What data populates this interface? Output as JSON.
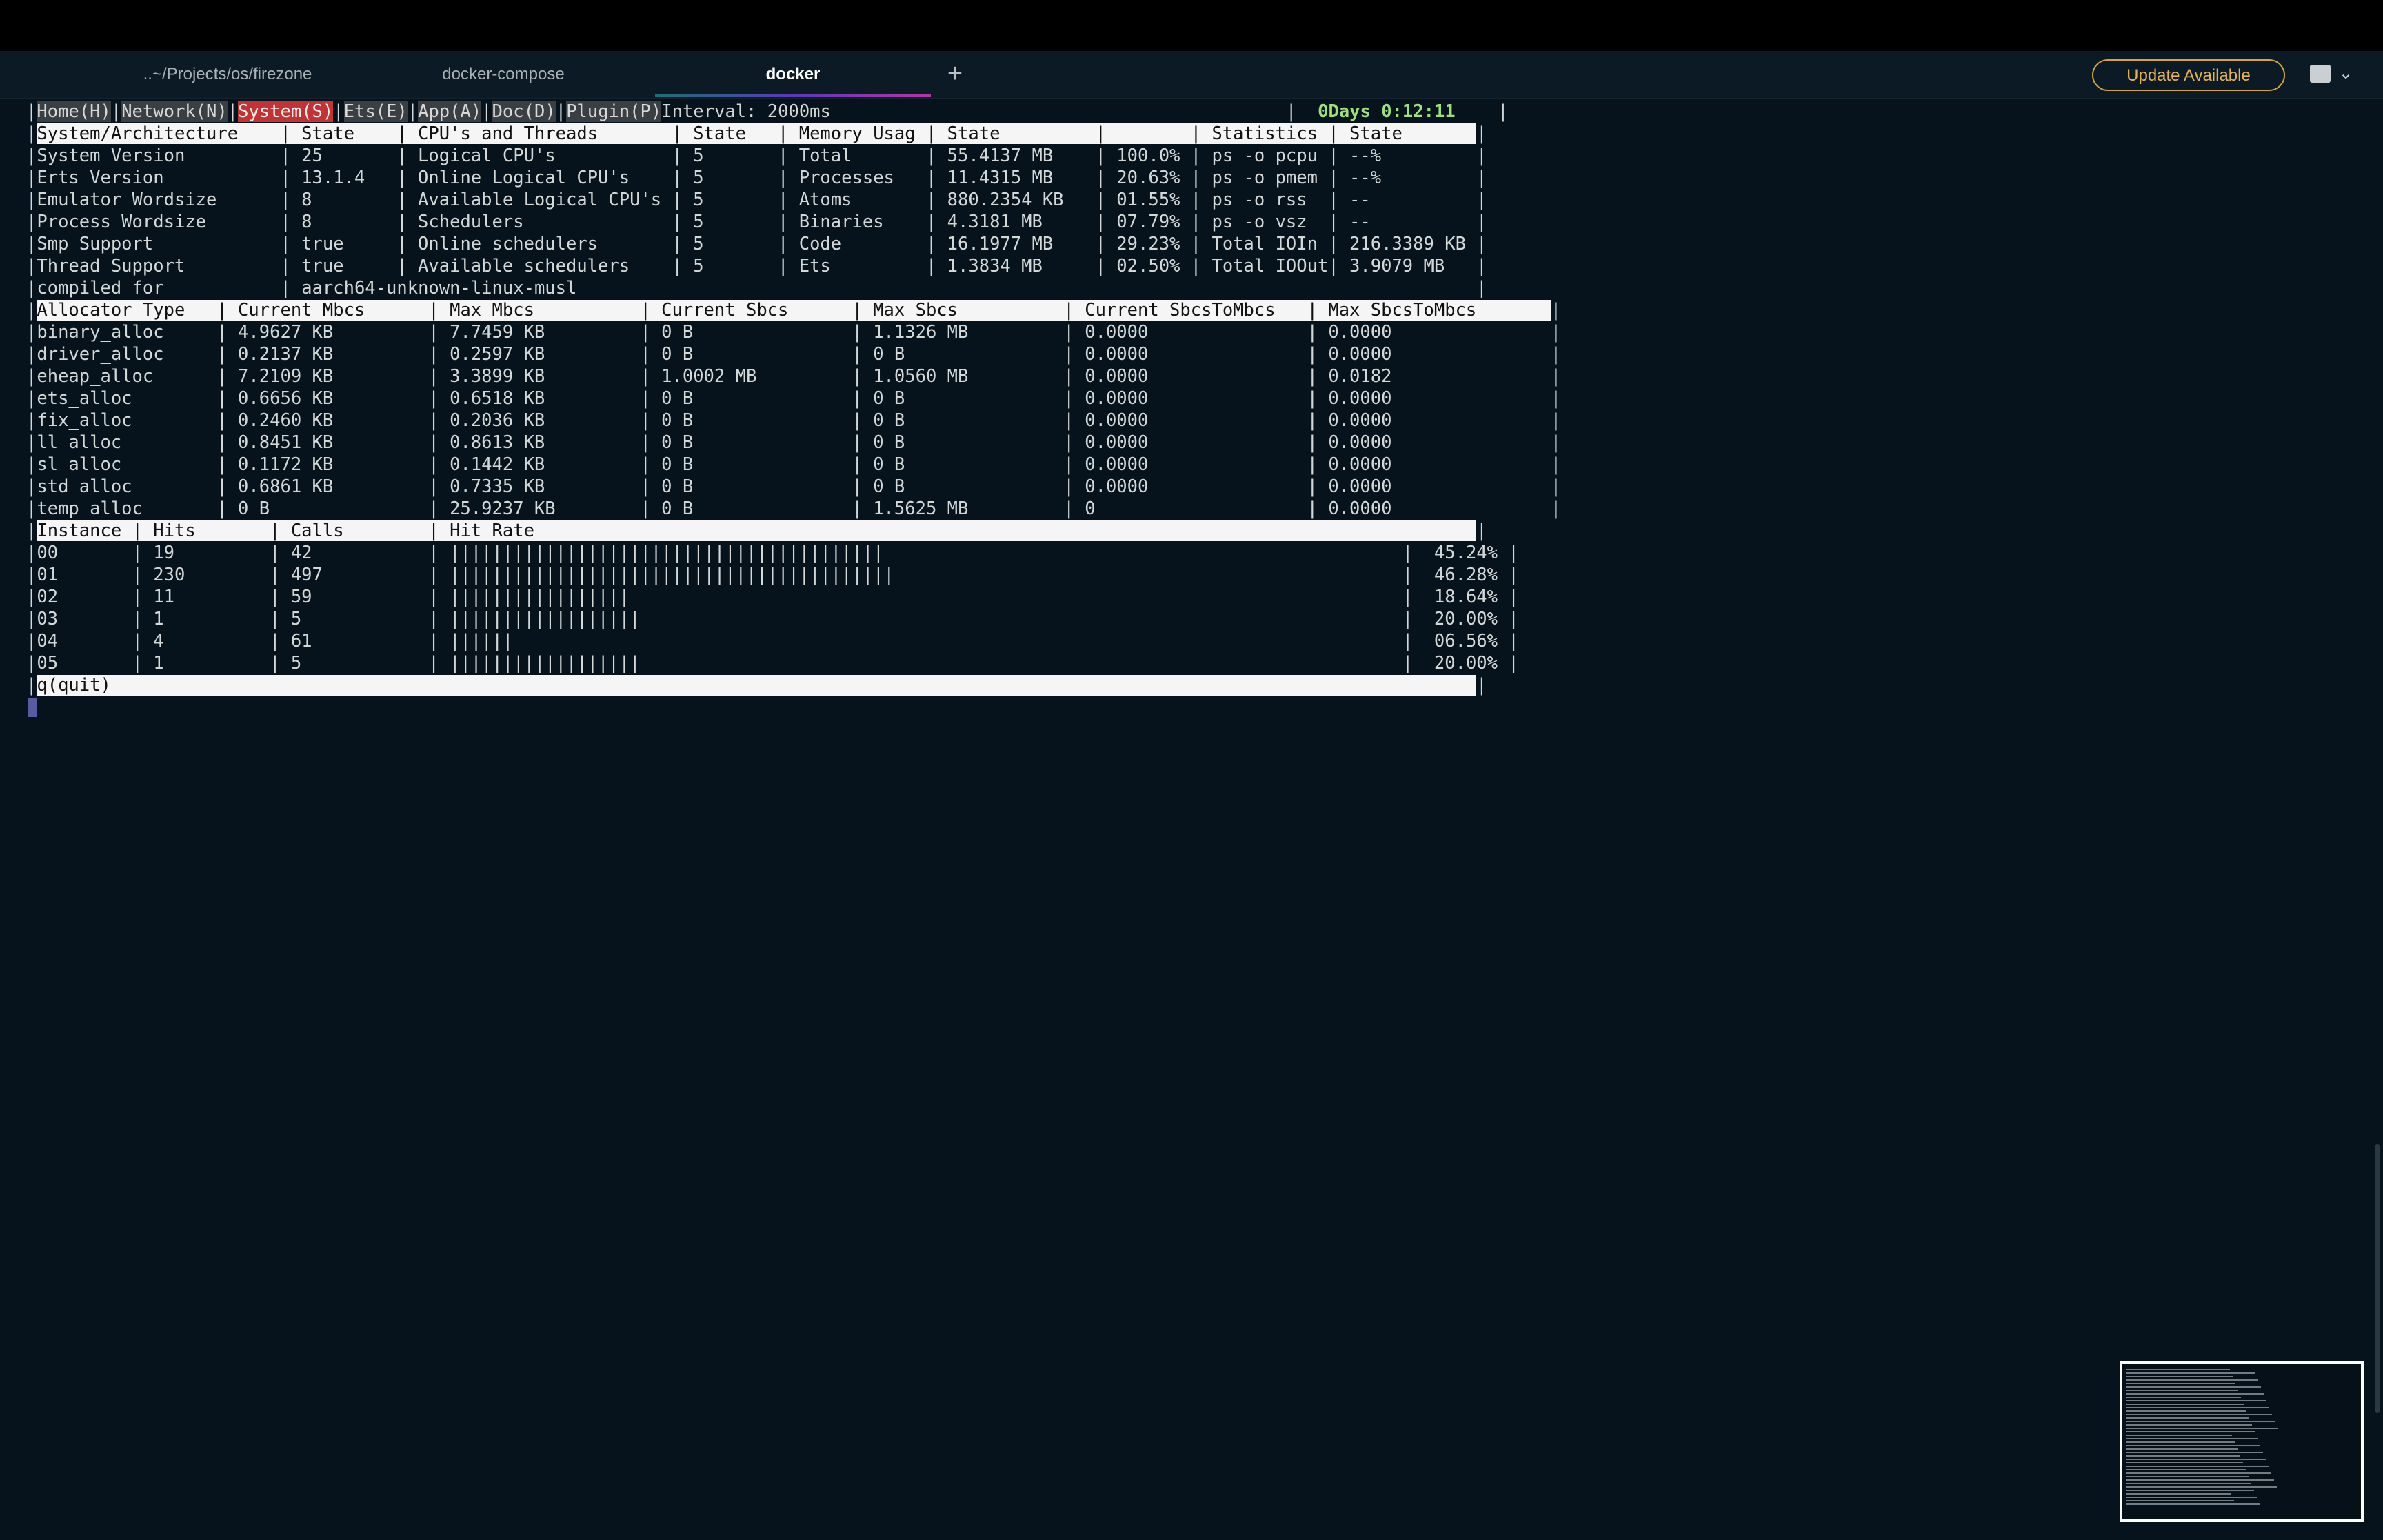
{
  "tabs": [
    {
      "label": "..~/Projects/os/firezone"
    },
    {
      "label": "docker-compose"
    },
    {
      "label": "docker"
    }
  ],
  "update_button": "Update Available",
  "nav": {
    "items": [
      "Home(H)",
      "Network(N)",
      "System(S)",
      "Ets(E)",
      "App(A)",
      "Doc(D)",
      "Plugin(P)"
    ],
    "interval": "Interval: 2000ms",
    "uptime": "0Days 0:12:11"
  },
  "system_headers": [
    "System/Architecture",
    "State",
    "CPU's and Threads",
    "State",
    "Memory Usag",
    "State",
    "",
    "Statistics",
    "State"
  ],
  "system_rows": [
    [
      "System Version",
      "25",
      "Logical CPU's",
      "5",
      "Total",
      "55.4137 MB",
      "100.0%",
      "ps -o pcpu",
      "--%"
    ],
    [
      "Erts Version",
      "13.1.4",
      "Online Logical CPU's",
      "5",
      "Processes",
      "11.4315 MB",
      "20.63%",
      "ps -o pmem",
      "--%"
    ],
    [
      "Emulator Wordsize",
      "8",
      "Available Logical CPU's",
      "5",
      "Atoms",
      "880.2354 KB",
      "01.55%",
      "ps -o rss",
      "--"
    ],
    [
      "Process Wordsize",
      "8",
      "Schedulers",
      "5",
      "Binaries",
      "4.3181 MB",
      "07.79%",
      "ps -o vsz",
      "--"
    ],
    [
      "Smp Support",
      "true",
      "Online schedulers",
      "5",
      "Code",
      "16.1977 MB",
      "29.23%",
      "Total IOIn",
      "216.3389 KB"
    ],
    [
      "Thread Support",
      "true",
      "Available schedulers",
      "5",
      "Ets",
      "1.3834 MB",
      "02.50%",
      "Total IOOut",
      "3.9079 MB"
    ]
  ],
  "compiled_for": {
    "label": "compiled for",
    "value": "aarch64-unknown-linux-musl"
  },
  "alloc_headers": [
    "Allocator Type",
    "Current Mbcs",
    "Max Mbcs",
    "Current Sbcs",
    "Max Sbcs",
    "Current SbcsToMbcs",
    "Max SbcsToMbcs"
  ],
  "alloc_rows": [
    [
      "binary_alloc",
      "4.9627 KB",
      "7.7459 KB",
      "0 B",
      "1.1326 MB",
      "0.0000",
      "0.0000"
    ],
    [
      "driver_alloc",
      "0.2137 KB",
      "0.2597 KB",
      "0 B",
      "0 B",
      "0.0000",
      "0.0000"
    ],
    [
      "eheap_alloc",
      "7.2109 KB",
      "3.3899 KB",
      "1.0002 MB",
      "1.0560 MB",
      "0.0000",
      "0.0182"
    ],
    [
      "ets_alloc",
      "0.6656 KB",
      "0.6518 KB",
      "0 B",
      "0 B",
      "0.0000",
      "0.0000"
    ],
    [
      "fix_alloc",
      "0.2460 KB",
      "0.2036 KB",
      "0 B",
      "0 B",
      "0.0000",
      "0.0000"
    ],
    [
      "ll_alloc",
      "0.8451 KB",
      "0.8613 KB",
      "0 B",
      "0 B",
      "0.0000",
      "0.0000"
    ],
    [
      "sl_alloc",
      "0.1172 KB",
      "0.1442 KB",
      "0 B",
      "0 B",
      "0.0000",
      "0.0000"
    ],
    [
      "std_alloc",
      "0.6861 KB",
      "0.7335 KB",
      "0 B",
      "0 B",
      "0.0000",
      "0.0000"
    ],
    [
      "temp_alloc",
      "0 B",
      "25.9237 KB",
      "0 B",
      "1.5625 MB",
      "0",
      "0.0000"
    ]
  ],
  "hit_headers": [
    "Instance",
    "Hits",
    "Calls",
    "Hit Rate"
  ],
  "hit_rows": [
    {
      "instance": "00",
      "hits": "19",
      "calls": "42",
      "rate": 45.24,
      "rate_label": "45.24%"
    },
    {
      "instance": "01",
      "hits": "230",
      "calls": "497",
      "rate": 46.28,
      "rate_label": "46.28%"
    },
    {
      "instance": "02",
      "hits": "11",
      "calls": "59",
      "rate": 18.64,
      "rate_label": "18.64%"
    },
    {
      "instance": "03",
      "hits": "1",
      "calls": "5",
      "rate": 20.0,
      "rate_label": "20.00%"
    },
    {
      "instance": "04",
      "hits": "4",
      "calls": "61",
      "rate": 6.56,
      "rate_label": "06.56%"
    },
    {
      "instance": "05",
      "hits": "1",
      "calls": "5",
      "rate": 20.0,
      "rate_label": "20.00%"
    }
  ],
  "footer": "q(quit)"
}
